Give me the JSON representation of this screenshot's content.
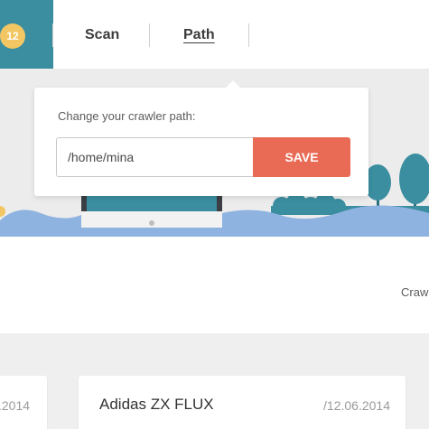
{
  "nav": {
    "badge_count": "12",
    "items": [
      {
        "label": "Scan",
        "active": false
      },
      {
        "label": "Path",
        "active": true
      }
    ]
  },
  "popover": {
    "label": "Change your crawler path:",
    "path_value": "/home/mina",
    "save_label": "SAVE"
  },
  "crawl_text": "Craw",
  "cards": [
    {
      "date": ".2014"
    },
    {
      "title": "Adidas ZX FLUX",
      "date": "/12.06.2014"
    }
  ],
  "colors": {
    "brand": "#3a8ea0",
    "badge": "#f2c763",
    "save": "#e96a55",
    "water": "#8fb3e0",
    "trees": "#3a8ea0"
  }
}
